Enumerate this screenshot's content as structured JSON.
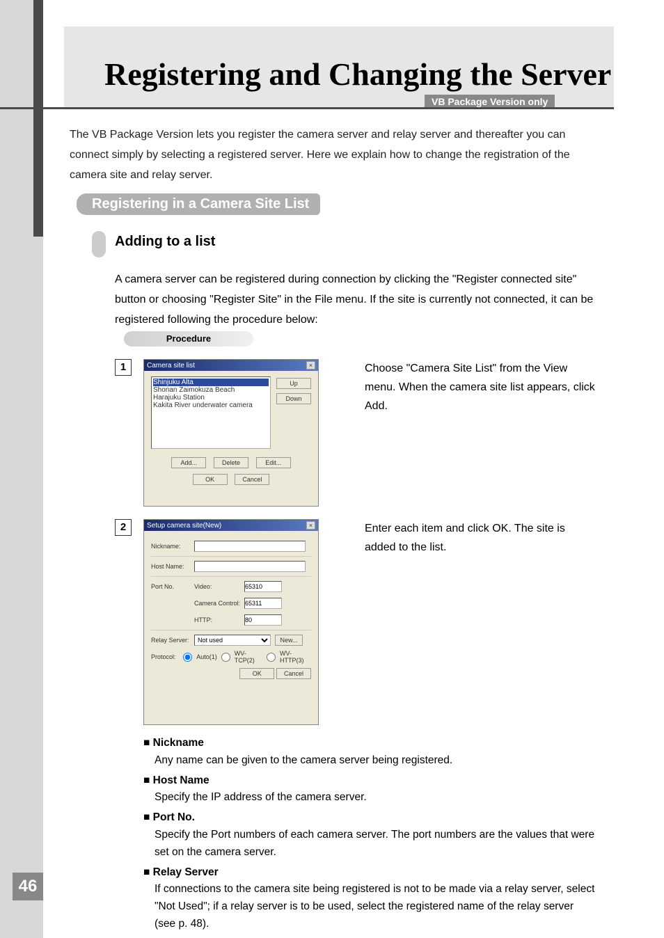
{
  "title": "Registering and Changing the Server",
  "version_tag": "VB Package Version only",
  "intro": "The VB Package Version lets you register the camera server and relay server and thereafter you can connect simply by selecting a registered server. Here we explain how to change the registration of the camera site and relay server.",
  "section1": "Registering in a Camera Site List",
  "adding": {
    "title": "Adding to a list",
    "desc": "A camera server can be registered during connection by clicking the \"Register connected site\" button or choosing \"Register Site\" in the File menu. If the site is currently not connected, it can be registered following the procedure below:"
  },
  "procedure_label": "Procedure",
  "steps": {
    "s1": {
      "num": "1",
      "text": "Choose \"Camera Site List\" from the View menu. When the camera site list appears, click Add."
    },
    "s2": {
      "num": "2",
      "text": "Enter each item and click OK. The site is added to the list."
    }
  },
  "dlg1": {
    "title": "Camera site list",
    "items": [
      "Shinjuku Alta",
      "Shonan Zaimokuza Beach",
      "Harajuku Station",
      "Kakita River underwater camera"
    ],
    "buttons": {
      "up": "Up",
      "down": "Down",
      "add": "Add...",
      "delete": "Delete",
      "edit": "Edit...",
      "ok": "OK",
      "cancel": "Cancel"
    }
  },
  "dlg2": {
    "title": "Setup camera site(New)",
    "labels": {
      "nickname": "Nickname:",
      "host": "Host Name:",
      "portno": "Port No.",
      "video": "Video:",
      "camcontrol": "Camera Control:",
      "http": "HTTP:",
      "relay": "Relay Server:",
      "protocol": "Protocol:",
      "new": "New..."
    },
    "values": {
      "video": "65310",
      "camcontrol": "65311",
      "http": "80",
      "relay": "Not used"
    },
    "radios": {
      "auto": "Auto(1)",
      "wvtcp": "WV-TCP(2)",
      "wvhttp": "WV-HTTP(3)"
    },
    "buttons": {
      "ok": "OK",
      "cancel": "Cancel"
    }
  },
  "definitions": [
    {
      "term": "Nickname",
      "desc": "Any name can be given to the camera server being registered."
    },
    {
      "term": "Host Name",
      "desc": "Specify the IP address of the camera server."
    },
    {
      "term": "Port No.",
      "desc": "Specify the Port numbers of each camera server. The port numbers are the values that were set on the camera server."
    },
    {
      "term": "Relay Server",
      "desc": "If connections to the camera site being registered is not to be made via a relay server, select \"Not Used\"; if a relay server is to be used, select the registered name of the relay server (see p. 48)."
    }
  ],
  "page_number": "46"
}
